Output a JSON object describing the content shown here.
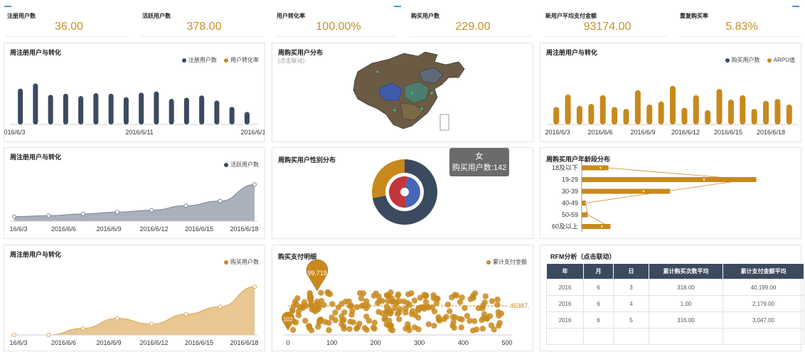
{
  "kpis": [
    {
      "label": "注册用户数",
      "value": "36.00"
    },
    {
      "label": "活跃用户数",
      "value": "378.00"
    },
    {
      "label": "用户转化率",
      "value": "100.00%"
    },
    {
      "label": "购买用户数",
      "value": "229.00"
    },
    {
      "label": "新用户平均支付金额",
      "value": "93174.00"
    },
    {
      "label": "重复购买率",
      "value": "5.83%"
    }
  ],
  "colors": {
    "navy": "#3b4a5e",
    "gold": "#c8891d",
    "sand": "#e8c792",
    "grey": "#aab0bc"
  },
  "panels": {
    "p1": {
      "title": "周注册用户与转化",
      "legend": [
        "注册用户数",
        "用户转化率"
      ]
    },
    "p2": {
      "title": "周购买用户分布",
      "subtitle": "(点击联动)"
    },
    "p3": {
      "title": "周注册用户与转化",
      "legend": [
        "购买用户数",
        "ARPU值"
      ]
    },
    "p4": {
      "title": "周注册用户与转化",
      "legend": [
        "活跃用户数"
      ]
    },
    "p5": {
      "title": "周购买用户性别分布",
      "tooltip": {
        "name": "女",
        "text": "购买用户数:142"
      }
    },
    "p6": {
      "title": "周购买用户年龄段分布"
    },
    "p7": {
      "title": "周注册用户与转化",
      "legend": [
        "购买用户数"
      ]
    },
    "p8": {
      "title": "购买支付明细",
      "legend": [
        "累计支付金额"
      ],
      "pin_value": "99,719",
      "min_label": "102",
      "avg_label": "46387."
    },
    "p9": {
      "title": "RFM分析（点击联动）"
    }
  },
  "chart_data": [
    {
      "type": "bar",
      "title": "周注册用户与转化",
      "series": [
        {
          "name": "注册用户数",
          "values": [
            63,
            72,
            52,
            54,
            50,
            55,
            54,
            48,
            56,
            58,
            45,
            47,
            51,
            42,
            31,
            22
          ]
        }
      ],
      "x_ticks": [
        "2016/6/3",
        "2016/6/11",
        "2016/6/1"
      ],
      "ylim": [
        0,
        80
      ]
    },
    {
      "type": "bar",
      "title": "周注册用户与转化",
      "series": [
        {
          "name": "购买用户数",
          "values": [
            28,
            48,
            30,
            33,
            47,
            28,
            25,
            55,
            32,
            37,
            62,
            27,
            47,
            23,
            57,
            40,
            47,
            25,
            38,
            41,
            32
          ]
        }
      ],
      "x_ticks": [
        "2016/6/3",
        "2016/6/6",
        "2016/6/9",
        "2016/6/12",
        "2016/6/15",
        "2016/6/18"
      ],
      "ylim": [
        0,
        80
      ]
    },
    {
      "type": "area",
      "title": "周注册用户与转化",
      "series": [
        {
          "name": "活跃用户数",
          "values": [
            5,
            6,
            8,
            10,
            12,
            17,
            22,
            40
          ]
        }
      ],
      "x_ticks": [
        "16/6/3",
        "2016/6/6",
        "2016/6/9",
        "2016/6/12",
        "2016/6/15",
        "2016/6/18"
      ],
      "ylim": [
        0,
        45
      ]
    },
    {
      "type": "donut",
      "title": "周购买用户性别分布",
      "outer": [
        {
          "name": "男",
          "value": 72
        },
        {
          "name": "女",
          "value": 28
        }
      ],
      "inner": [
        {
          "name": "a",
          "value": 45
        },
        {
          "name": "b",
          "value": 55
        }
      ]
    },
    {
      "type": "bar",
      "orientation": "horizontal",
      "title": "周购买用户年龄段分布",
      "categories": [
        "18及以下",
        "19-29",
        "30-39",
        "40-49",
        "50-59",
        "60及以上"
      ],
      "values": [
        13,
        85,
        43,
        2,
        3,
        14
      ]
    },
    {
      "type": "area",
      "title": "周注册用户与转化",
      "series": [
        {
          "name": "购买用户数",
          "values": [
            0,
            0,
            8,
            20,
            13,
            25,
            34,
            58
          ]
        }
      ],
      "x_ticks": [
        "16/6/3",
        "2016/6/6",
        "2016/6/9",
        "2016/6/12",
        "2016/6/15",
        "2016/6/18"
      ],
      "ylim": [
        0,
        65
      ]
    },
    {
      "type": "scatter",
      "title": "购买支付明细",
      "series": [
        {
          "name": "累计支付金额"
        }
      ],
      "x_ticks": [
        "0",
        "100",
        "200",
        "300",
        "400",
        "500"
      ],
      "xlim": [
        0,
        500
      ],
      "ylim": [
        0,
        100000
      ],
      "avg": 46387,
      "max": 99719,
      "min": 102
    }
  ],
  "rfm": {
    "headers": [
      "年",
      "月",
      "日",
      "累计购买次数平均",
      "累计支付金额平均"
    ],
    "rows": [
      [
        "2016",
        "6",
        "3",
        "318.00",
        "40,199.00"
      ],
      [
        "2016",
        "6",
        "4",
        "1.00",
        "2,179.00"
      ],
      [
        "2016",
        "6",
        "5",
        "316.00",
        "3,047.00"
      ]
    ]
  }
}
